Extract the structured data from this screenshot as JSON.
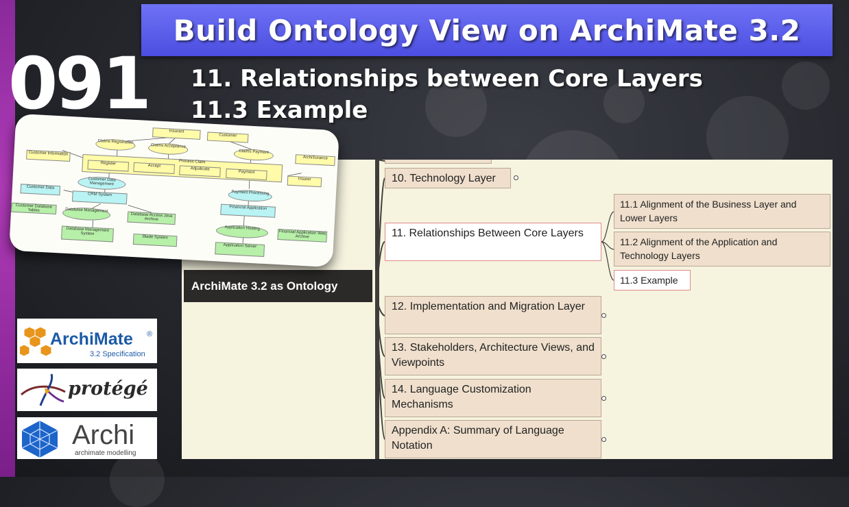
{
  "slide": {
    "title": "Build Ontology View on ArchiMate 3.2",
    "episode": "091",
    "subtitle_line1": "11. Relationships between Core Layers",
    "subtitle_line2": "11.3 Example"
  },
  "mindmap": {
    "root": "ArchiMate 3.2 as Ontology",
    "branches": [
      {
        "label": "10. Technology Layer"
      },
      {
        "label": "11. Relationships Between Core Layers"
      },
      {
        "label": "12. Implementation and Migration Layer"
      },
      {
        "label": "13. Stakeholders, Architecture Views, and Viewpoints"
      },
      {
        "label": "14. Language Customization Mechanisms"
      },
      {
        "label": "Appendix A: Summary of Language Notation"
      }
    ],
    "children_11": [
      {
        "label": "11.1 Alignment of the Business Layer and Lower Layers"
      },
      {
        "label": "11.2 Alignment of the Application and Technology Layers"
      },
      {
        "label": "11.3 Example"
      }
    ]
  },
  "logos": {
    "archimate_name": "ArchiMate",
    "archimate_reg": "®",
    "archimate_spec": "3.2 Specification",
    "protege_name": "protégé",
    "archi_name": "Archi",
    "archi_tagline": "archimate modelling"
  },
  "thumbnail": {
    "labels": {
      "insurant": "Insurant",
      "customer": "Customer",
      "claims_registration": "Claims Registration",
      "claims_acceptance": "Claims Acceptance",
      "claims_payment": "Claims Payment",
      "archisurance": "ArchiSurance",
      "customer_information": "Customer Information",
      "process_claim": "Process Claim",
      "register": "Register",
      "accept": "Accept",
      "adjudicate": "Adjudicate",
      "payment": "Payment",
      "insurer": "Insurer",
      "customer_data_management": "Customer Data Management",
      "payment_processing": "Payment Processing",
      "customer_data": "Customer Data",
      "crm_system": "CRM System",
      "financial_application": "Financial Application",
      "customer_database_tables": "Customer Database Tables",
      "database_management": "Database Management",
      "database_access": "Database Access Java Archive",
      "application_hosting": "Application Hosting",
      "financial_app_web_archive": "Financial Application Web Archive",
      "dbms": "Database Management System",
      "blade_system": "Blade System",
      "application_server": "Application Server"
    }
  },
  "colors": {
    "banner": "#5a5df0",
    "left_bar": "#a034b0",
    "mindmap_bg": "#f6f3df",
    "node_fill": "#efdfcc",
    "root_fill": "#2b2a28",
    "highlight_border": "#e08a8a"
  }
}
